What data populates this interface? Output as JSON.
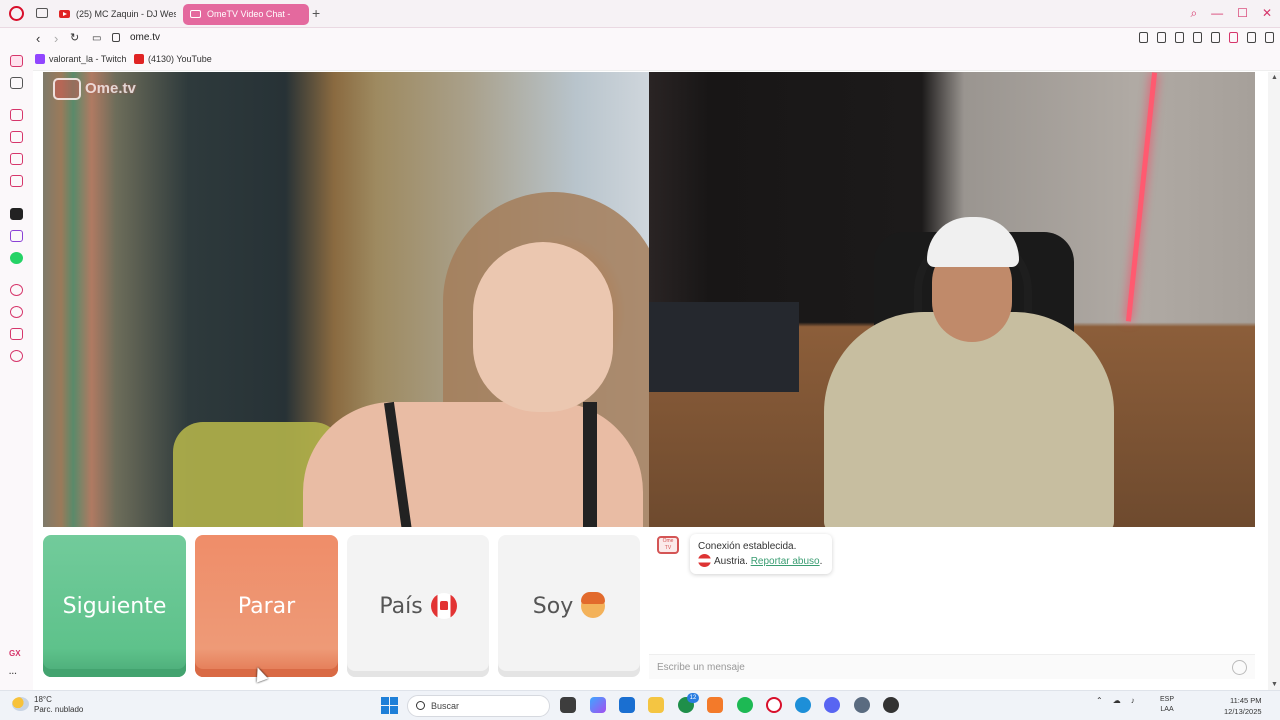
{
  "browser": {
    "tabs": [
      {
        "label": "(25) MC Zaquin - DJ Wes",
        "icon": "youtube-icon"
      },
      {
        "label": "OmeTV Video Chat -",
        "icon": "speaker-icon",
        "active": true
      }
    ],
    "url": "ome.tv",
    "bookmarks": [
      {
        "label": "valorant_la - Twitch",
        "icon": "twitch-icon"
      },
      {
        "label": "(4130) YouTube",
        "icon": "youtube-icon"
      }
    ],
    "sidebar_text": {
      "gx": "GX",
      "more": "···"
    }
  },
  "ometv": {
    "watermark": "Ome.tv",
    "buttons": {
      "next": "Siguiente",
      "stop": "Parar",
      "country": "País",
      "gender": "Soy"
    },
    "chat": {
      "logo_text": "Ome TV",
      "status": "Conexión establecida.",
      "country": "Austria.",
      "report_link": "Reportar abuso",
      "report_suffix": ".",
      "input_placeholder": "Escribe un mensaje"
    }
  },
  "taskbar": {
    "weather_temp": "18°C",
    "weather_desc": "Parc. nublado",
    "search_placeholder": "Buscar",
    "notification_badge": "12",
    "lang_line1": "ESP",
    "lang_line2": "LAA",
    "time": "11:45 PM",
    "date": "12/13/2025"
  },
  "colors": {
    "accent": "#d6366b",
    "next_button": "#5ec28b",
    "stop_button": "#ee9a77",
    "neutral_button": "#f3f3f3",
    "report_link": "#3a9d72"
  }
}
